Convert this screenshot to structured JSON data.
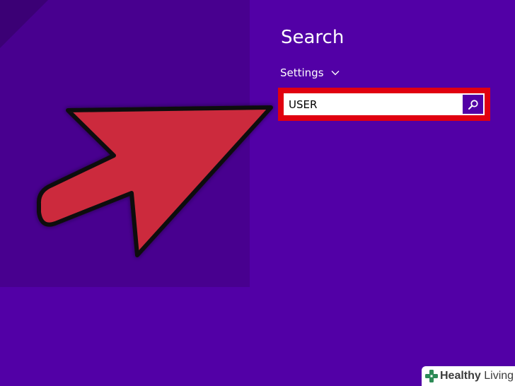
{
  "colors": {
    "background": "#5200a6",
    "start_area": "#48008f",
    "highlight_border": "#e00010",
    "arrow_fill": "#cc2a3e",
    "accent": "#5200a6"
  },
  "charm": {
    "title": "Search",
    "scope": {
      "label": "Settings",
      "icon": "chevron-down-icon"
    },
    "search": {
      "value": "USER",
      "placeholder": "",
      "button_icon": "search-icon"
    }
  },
  "annotation": {
    "icon": "pointer-arrow-icon"
  },
  "watermark": {
    "brand_bold": "Healthy",
    "brand_rest": "Living"
  }
}
